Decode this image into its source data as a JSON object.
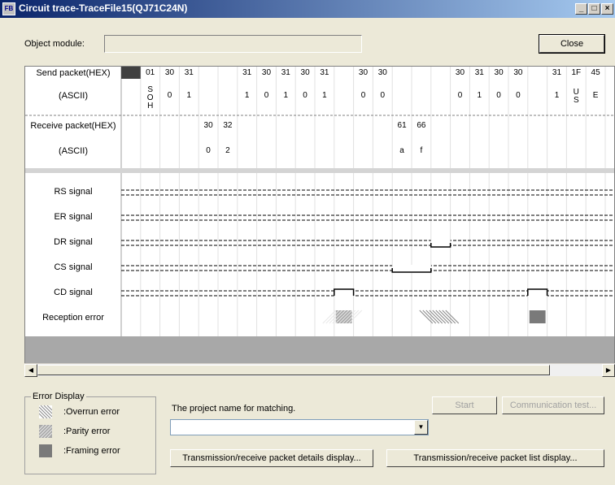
{
  "window": {
    "title": "Circuit trace-TraceFile15(QJ71C24N)",
    "app_icon_text": "FB",
    "minimize": "_",
    "maximize": "□",
    "close": "×"
  },
  "object_module": {
    "label": "Object module:",
    "value": ""
  },
  "close_button": "Close",
  "trace": {
    "send_hex_label": "Send packet(HEX)",
    "send_ascii_label": "(ASCII)",
    "recv_hex_label": "Receive packet(HEX)",
    "recv_ascii_label": "(ASCII)",
    "send_hex": [
      "",
      "01",
      "30",
      "31",
      "",
      "",
      "31",
      "30",
      "31",
      "30",
      "31",
      "",
      "30",
      "30",
      "",
      "",
      "",
      "30",
      "31",
      "30",
      "30",
      "",
      "31",
      "1F",
      "45"
    ],
    "send_ascii": [
      "",
      "SOH",
      "0",
      "1",
      "",
      "",
      "1",
      "0",
      "1",
      "0",
      "1",
      "",
      "0",
      "0",
      "",
      "",
      "",
      "0",
      "1",
      "0",
      "0",
      "",
      "1",
      "US",
      "E"
    ],
    "recv_hex": [
      "",
      "",
      "",
      "",
      "30",
      "32",
      "",
      "",
      "",
      "",
      "",
      "",
      "",
      "",
      "61",
      "66",
      "",
      "",
      "",
      "",
      "",
      "",
      "",
      "",
      ""
    ],
    "recv_ascii": [
      "",
      "",
      "",
      "",
      "0",
      "2",
      "",
      "",
      "",
      "",
      "",
      "",
      "",
      "",
      "a",
      "f",
      "",
      "",
      "",
      "",
      "",
      "",
      "",
      "",
      ""
    ],
    "signals": [
      {
        "label": "RS signal"
      },
      {
        "label": "ER signal"
      },
      {
        "label": "DR signal"
      },
      {
        "label": "CS signal"
      },
      {
        "label": "CD signal"
      }
    ],
    "reception_error_label": "Reception error"
  },
  "error_display": {
    "title": "Error Display",
    "overrun": ":Overrun error",
    "parity": ":Parity error",
    "framing": ":Framing error"
  },
  "project": {
    "label": "The project name for matching.",
    "value": ""
  },
  "buttons": {
    "start": "Start",
    "comm_test": "Communication test...",
    "details": "Transmission/receive packet details display...",
    "list": "Transmission/receive packet list display..."
  }
}
